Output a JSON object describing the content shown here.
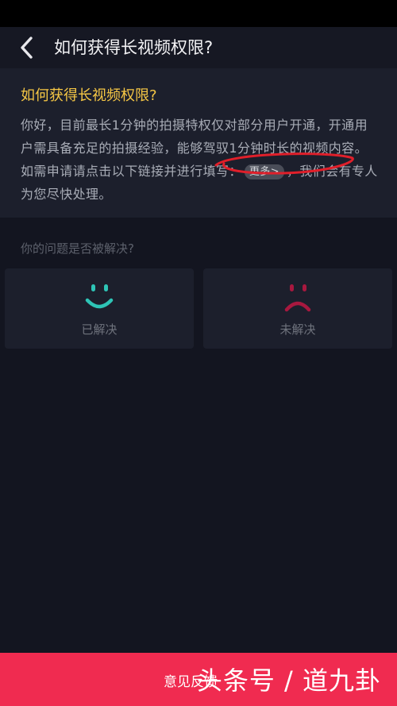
{
  "header": {
    "title": "如何获得长视频权限?"
  },
  "answer": {
    "question": "如何获得长视频权限?",
    "body_before": "你好，目前最长1分钟的拍摄特权仅对部分用户开通，开通用户需具备充足的拍摄经验，能够驾驭1分钟时长的视频内容。如需申请请点击以下链接并进行填写：",
    "more_label": "更多>",
    "body_after": "，我们会有专人为您尽快处理。"
  },
  "feedback": {
    "question": "你的问题是否被解决?",
    "solved_label": "已解决",
    "unsolved_label": "未解决",
    "solved_color": "#2ec4b6",
    "unsolved_color": "#a8183f"
  },
  "footer": {
    "label": "意见反馈"
  },
  "watermark": {
    "text": "头条号 / 道九卦"
  },
  "colors": {
    "background": "#131520",
    "card": "#1c1f2c",
    "accent_yellow": "#f6c745",
    "footer_red": "#f02b50",
    "annotation_red": "#e01f2a"
  }
}
